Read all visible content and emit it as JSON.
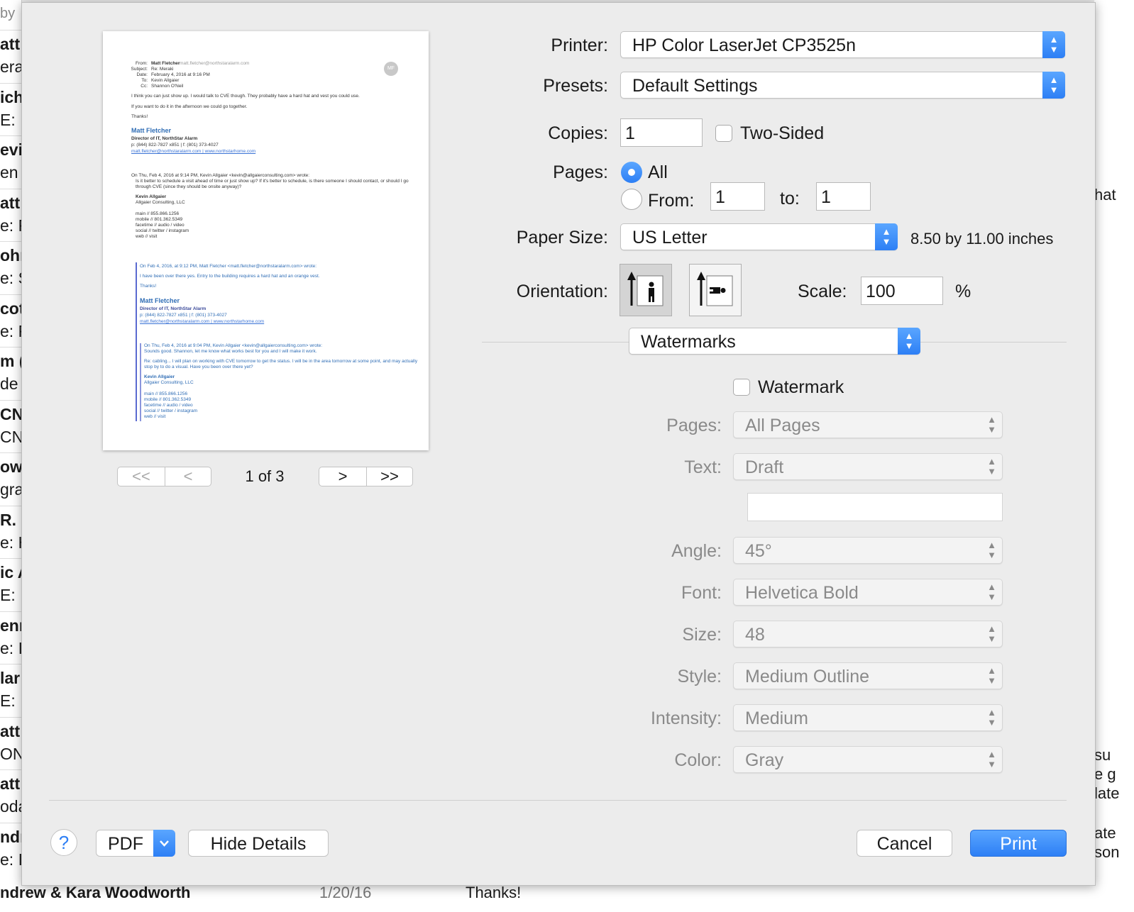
{
  "background": {
    "left_header": "by",
    "left_items": [
      {
        "sender": "att",
        "preview": "era"
      },
      {
        "sender": "ich",
        "preview": "E: L"
      },
      {
        "sender": "evi",
        "preview": "en"
      },
      {
        "sender": "att",
        "preview": "e: R"
      },
      {
        "sender": "ohn",
        "preview": "e: S"
      },
      {
        "sender": "cot",
        "preview": "e: R"
      },
      {
        "sender": "m (",
        "preview": "de"
      },
      {
        "sender": "CN",
        "preview": "CN"
      },
      {
        "sender": "owl",
        "preview": "gra"
      },
      {
        "sender": "R. I",
        "preview": "e: H"
      },
      {
        "sender": "ic A",
        "preview": "E: Ir"
      },
      {
        "sender": "enn",
        "preview": "e: Ir"
      },
      {
        "sender": "lar",
        "preview": "E: Ir"
      },
      {
        "sender": "att",
        "preview": "ON"
      },
      {
        "sender": "att",
        "preview": "oda"
      },
      {
        "sender": "ndr",
        "preview": "e: Ir"
      }
    ],
    "right_fragments": [
      "hat",
      "su",
      "e g",
      "late",
      "ate",
      "son"
    ],
    "bottom_sender": "ndrew & Kara Woodworth",
    "bottom_date": "1/20/16",
    "bottom_body": "Thanks!"
  },
  "dialog": {
    "printer_label": "Printer:",
    "printer_value": "HP Color LaserJet CP3525n",
    "presets_label": "Presets:",
    "presets_value": "Default Settings",
    "copies_label": "Copies:",
    "copies_value": "1",
    "two_sided_label": "Two-Sided",
    "pages_label": "Pages:",
    "pages_all_label": "All",
    "pages_from_label": "From:",
    "pages_from_value": "1",
    "pages_to_label": "to:",
    "pages_to_value": "1",
    "paper_size_label": "Paper Size:",
    "paper_size_value": "US Letter",
    "paper_size_dims": "8.50 by 11.00 inches",
    "orientation_label": "Orientation:",
    "scale_label": "Scale:",
    "scale_value": "100",
    "scale_unit": "%",
    "section_value": "Watermarks",
    "watermark_label": "Watermark",
    "wm_pages_label": "Pages:",
    "wm_pages_value": "All Pages",
    "wm_text_label": "Text:",
    "wm_text_value": "Draft",
    "wm_text_custom": "",
    "wm_angle_label": "Angle:",
    "wm_angle_value": "45°",
    "wm_font_label": "Font:",
    "wm_font_value": "Helvetica Bold",
    "wm_size_label": "Size:",
    "wm_size_value": "48",
    "wm_style_label": "Style:",
    "wm_style_value": "Medium Outline",
    "wm_intensity_label": "Intensity:",
    "wm_intensity_value": "Medium",
    "wm_color_label": "Color:",
    "wm_color_value": "Gray",
    "help_label": "?",
    "pdf_label": "PDF",
    "hide_details_label": "Hide Details",
    "cancel_label": "Cancel",
    "print_label": "Print",
    "page_indicator": "1 of 3",
    "nav_first": "<<",
    "nav_prev": "<",
    "nav_next": ">",
    "nav_last": ">>"
  },
  "preview": {
    "from_label": "From:",
    "from_name": "Matt Fletcher",
    "from_email": "matt.fletcher@northstaralarm.com",
    "subject_label": "Subject:",
    "subject": "Re: Meraki",
    "date_label": "Date:",
    "date": "February 4, 2016 at 9:16 PM",
    "to_label": "To:",
    "to": "Kevin Allgaier",
    "cc_label": "Cc:",
    "cc": "Shannon O'Neil",
    "avatar": "MF",
    "line1": "I think you can just show up. I would talk to CVE though. They probably have a hard hat and vest you could use.",
    "line2": "If you want to do it in the afternoon we could go together.",
    "line3": "Thanks!",
    "sig_name": "Matt Fletcher",
    "sig_title": "Director of IT, NorthStar Alarm",
    "sig_phone": "p: (844) 822-7827 x851 | f: (801) 373-4027",
    "sig_links": "matt.fletcher@northstaralarm.com | www.northstarhome.com",
    "q1_header": "On Thu, Feb 4, 2016 at 9:14 PM, Kevin Allgaier <kevin@allgaierconsulting.com> wrote:",
    "q1_body1": "Is it better to schedule a visit ahead of time or just show up? If it's better to schedule, is there someone I should contact, or should I go",
    "q1_body2": "through CVE (since they should be onsite anyway)?",
    "q1_sig_name": "Kevin Allgaier",
    "q1_sig_co": "Allgaier Consulting, LLC",
    "q1_main": "main // 855.866.1256",
    "q1_mobile": "mobile // 801.362.5349",
    "q1_facetime": "facetime // audio / video",
    "q1_social": "social // twitter / instagram",
    "q1_web": "web // visit",
    "q2_header": "On Feb 4, 2016, at 9:12 PM, Matt Fletcher <matt.fletcher@northstaralarm.com> wrote:",
    "q2_body": "I have been over there yes. Entry to the building requires a hard hat and an orange vest.",
    "q2_thanks": "Thanks!",
    "q2_sig_name": "Matt Fletcher",
    "q2_sig_title": "Director of IT, NorthStar Alarm",
    "q2_sig_phone": "p: (844) 822-7827 x851 | f: (801) 373-4027",
    "q2_sig_links": "matt.fletcher@northstaralarm.com | www.northstarhome.com",
    "q3_header": "On Thu, Feb 4, 2016 at 9:04 PM, Kevin Allgaier <kevin@allgaierconsulting.com> wrote:",
    "q3_body": "Sounds good. Shannon, let me know what works best for you and I will make it work.",
    "q3_body2": "Re: cabling... I will plan on working with CVE tomorrow to get the status. I will be in the area tomorrow at some point, and may actually",
    "q3_body3": "stop by to do a visual. Have you been over there yet?",
    "q3_sig_name": "Kevin Allgaier",
    "q3_sig_co": "Allgaier Consulting, LLC",
    "q3_main": "main // 855.866.1256",
    "q3_mobile": "mobile // 801.362.5349",
    "q3_facetime": "facetime // audio / video",
    "q3_social": "social // twitter / instagram",
    "q3_web": "web // visit"
  },
  "colors": {
    "accent": "#2d7ff5",
    "dim_text": "#8a8a8a"
  },
  "icons": {
    "popup": "updown-chevron-icon",
    "help": "question-icon",
    "portrait": "portrait-orientation-icon",
    "landscape": "landscape-orientation-icon"
  }
}
